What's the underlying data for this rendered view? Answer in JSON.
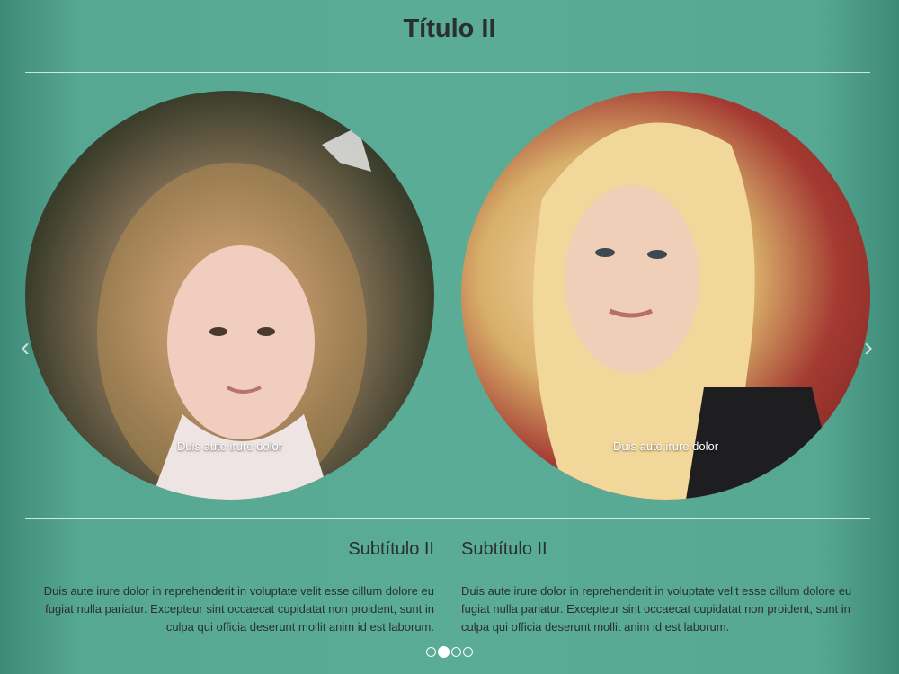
{
  "page": {
    "title": "Título II"
  },
  "slides": [
    {
      "caption": "Duis aute irure dolor",
      "photo_icon": "portrait-child-photo"
    },
    {
      "caption": "Duis aute irure dolor",
      "photo_icon": "portrait-woman-photo"
    }
  ],
  "nav": {
    "prev_glyph": "‹",
    "next_glyph": "›"
  },
  "columns": [
    {
      "subtitle": "Subtítulo II",
      "text": "Duis aute irure dolor in reprehenderit in voluptate velit esse cillum dolore eu fugiat nulla pariatur. Excepteur sint occaecat cupidatat non proident, sunt in culpa qui officia deserunt mollit anim id est laborum."
    },
    {
      "subtitle": "Subtítulo II",
      "text": "Duis aute irure dolor in reprehenderit in voluptate velit esse cillum dolore eu fugiat nulla pariatur. Excepteur sint occaecat cupidatat non proident, sunt in culpa qui officia deserunt mollit anim id est laborum."
    }
  ],
  "pagination": {
    "count": 4,
    "active_index": 1
  },
  "colors": {
    "background": "#5aac96",
    "text": "#2b2f2e",
    "accent": "#ffffff"
  }
}
